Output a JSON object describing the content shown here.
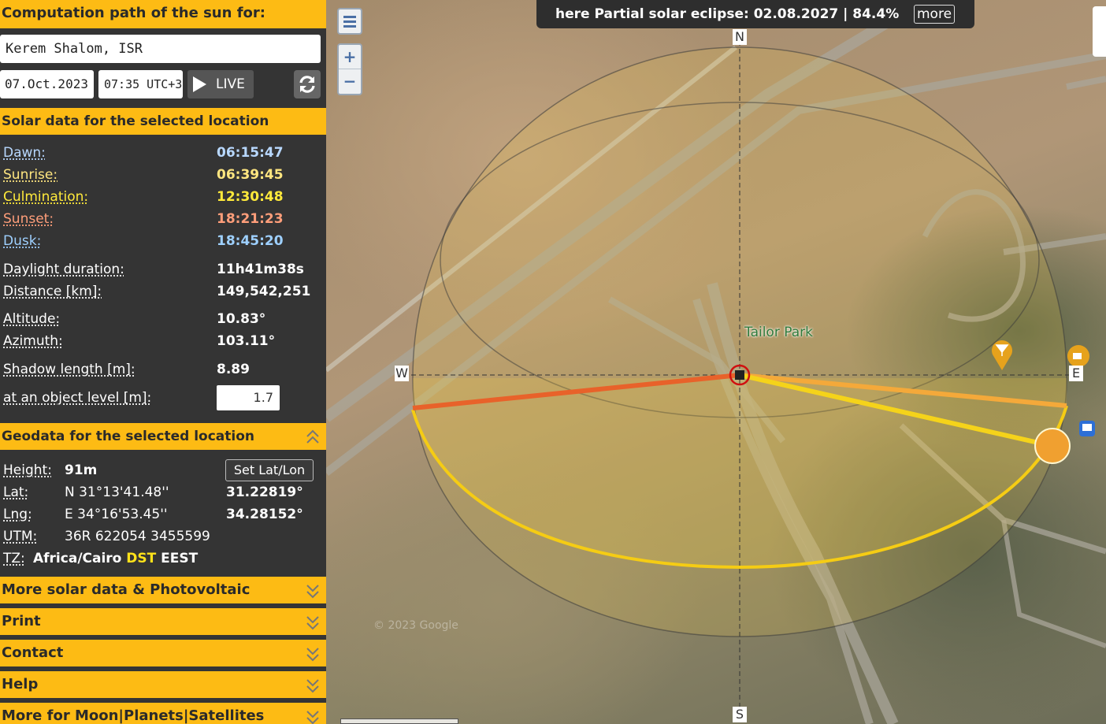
{
  "sidebar": {
    "title": "Computation path of the sun for:",
    "location": "Kerem Shalom, ISR",
    "date": "07.Oct.2023",
    "time": "07:35 UTC+3",
    "live_label": "LIVE",
    "solar_header": "Solar data for the selected location",
    "solar": {
      "dawn_label": "Dawn:",
      "dawn": "06:15:47",
      "sunrise_label": "Sunrise:",
      "sunrise": "06:39:45",
      "culmination_label": "Culmination:",
      "culmination": "12:30:48",
      "sunset_label": "Sunset:",
      "sunset": "18:21:23",
      "dusk_label": "Dusk:",
      "dusk": "18:45:20",
      "daylight_label": "Daylight duration:",
      "daylight": "11h41m38s",
      "distance_label": "Distance [km]:",
      "distance": "149,542,251",
      "altitude_label": "Altitude:",
      "altitude": "10.83°",
      "azimuth_label": "Azimuth:",
      "azimuth": "103.11°",
      "shadow_label": "Shadow length [m]:",
      "shadow": "8.89",
      "object_level_label": "at an object level [m]:",
      "object_level": "1.7"
    },
    "geo_header": "Geodata for the selected location",
    "geo": {
      "height_label": "Height:",
      "height": "91m",
      "set_latlon": "Set Lat/Lon",
      "lat_label": "Lat:",
      "lat_dms": "N 31°13'41.48''",
      "lat_dec": "31.22819°",
      "lng_label": "Lng:",
      "lng_dms": "E 34°16'53.45''",
      "lng_dec": "34.28152°",
      "utm_label": "UTM:",
      "utm": "36R 622054 3455599",
      "tz_label": "TZ:",
      "tz_zone": "Africa/Cairo",
      "tz_dst": "DST",
      "tz_abbr": "EEST"
    },
    "sections": [
      "More solar data & Photovoltaic",
      "Print",
      "Contact",
      "Help",
      "More for Moon|Planets|Satellites"
    ]
  },
  "map": {
    "eclipse_text": "here Partial solar eclipse: 02.08.2027 | 84.4%",
    "more_label": "more",
    "compass": {
      "n": "N",
      "s": "S",
      "w": "W",
      "e": "E"
    },
    "poi_label": "Tailor Park",
    "zoom_in": "+",
    "zoom_out": "−",
    "watermark": "© 2023 Google"
  },
  "colors": {
    "accent": "#fdbb14",
    "panel": "#343434",
    "sunrise_line": "#f4a93a",
    "sunset_line": "#e8622a",
    "current_sun_line": "#f5d31a",
    "sun_marker": "#f0a030"
  }
}
